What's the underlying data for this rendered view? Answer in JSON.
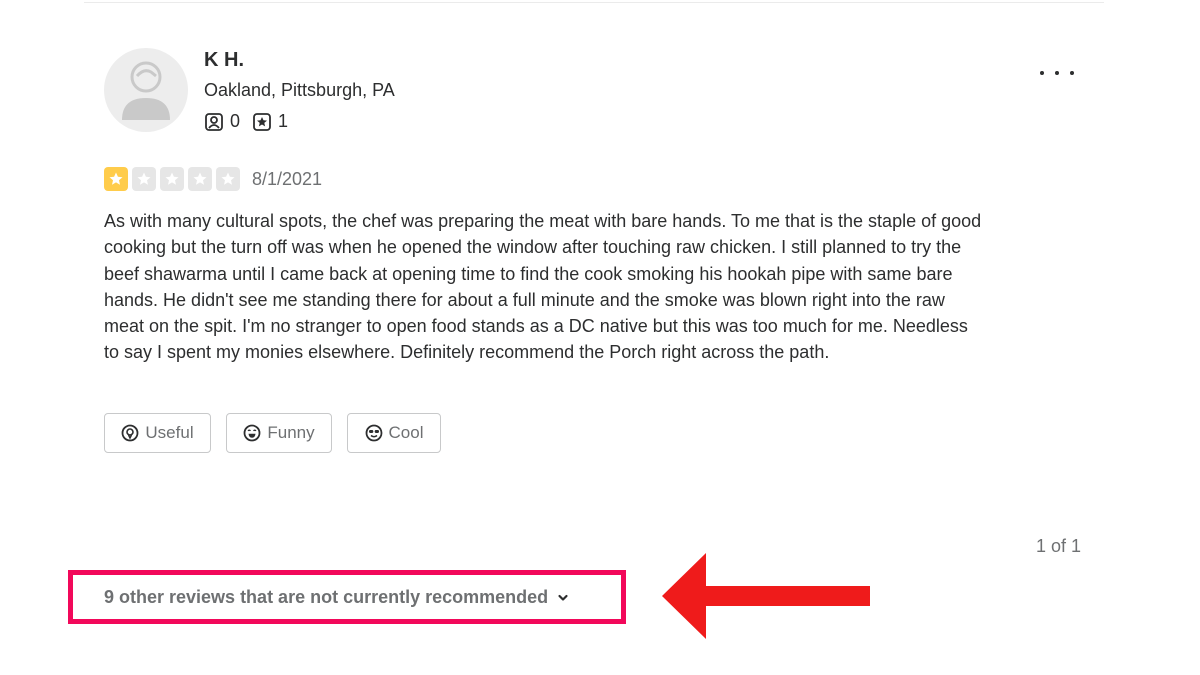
{
  "user": {
    "name": "K H.",
    "location": "Oakland, Pittsburgh, PA",
    "friends_count": "0",
    "reviews_count": "1"
  },
  "review": {
    "rating": 1,
    "max_rating": 5,
    "date": "8/1/2021",
    "text": "As with many cultural spots, the chef was preparing the meat with bare hands. To me that is the staple of good cooking but the turn off was when he opened the window after touching raw chicken. I still planned to try the beef shawarma until I came back at opening time to find the cook smoking his hookah pipe with same bare hands. He didn't see me standing there for about a full minute and the smoke was blown right into the raw meat on the spit. I'm no stranger to open food stands as a DC native but this was too much for me. Needless to say I spent my monies elsewhere. Definitely recommend the Porch right across the path."
  },
  "reactions": {
    "useful_label": "Useful",
    "funny_label": "Funny",
    "cool_label": "Cool"
  },
  "pagination": {
    "label": "1 of 1"
  },
  "not_recommended": {
    "label": "9 other reviews that are not currently recommended"
  },
  "colors": {
    "star_filled": "#ffcc4b",
    "star_empty": "#e6e6e6",
    "highlight_border": "#f2085a",
    "arrow": "#ef1b1b"
  },
  "icons": {
    "more": "more-horizontal-icon",
    "friends": "friends-icon",
    "reviews": "review-star-icon",
    "useful": "useful-icon",
    "funny": "funny-icon",
    "cool": "cool-icon",
    "chevron": "chevron-down-icon"
  }
}
